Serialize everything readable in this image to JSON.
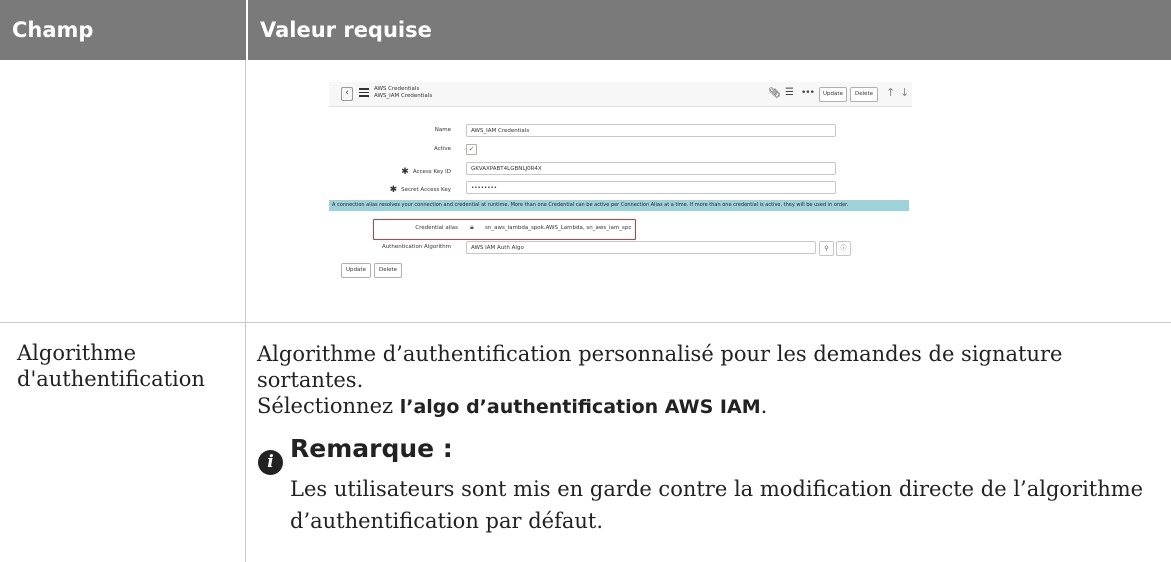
{
  "table": {
    "header_field": "Champ",
    "header_value": "Valeur requise"
  },
  "screenshot": {
    "title_line1": "AWS Credentials",
    "title_line2": "AWS_IAM Credentials",
    "update_label": "Update",
    "delete_label": "Delete",
    "fields": {
      "name_label": "Name",
      "name_value": "AWS_IAM Credentials",
      "active_label": "Active",
      "active_checked": true,
      "access_key_label": "Access Key ID",
      "access_key_value": "GKVAXPABT4LGBNLJ0R4X",
      "secret_label": "Secret Access Key",
      "secret_value": "••••••••",
      "alias_label": "Credential alias",
      "alias_value": "sn_aws_lambda_spok.AWS_Lambda, sn_aws_iam_spoke.AWS_IAM",
      "algo_label": "Authentication Algorithm",
      "algo_value": "AWS IAM Auth Algo"
    },
    "info_message": "A connection alias resolves your connection and credential at runtime. More than one Credential can be active per Connection Alias at a time. If more than one credential is active, they will be used in order.",
    "bottom_update": "Update",
    "bottom_delete": "Delete",
    "icons": [
      "back-icon",
      "menu-icon",
      "paperclip-icon",
      "sliders-icon",
      "more-icon",
      "arrow-up-icon",
      "arrow-down-icon",
      "lock-icon",
      "search-icon",
      "info-icon",
      "checkmark-icon"
    ]
  },
  "row2": {
    "field": "Algorithme d'authentification",
    "desc_line1": "Algorithme d’authentification personnalisé pour les demandes de signature sortantes.",
    "desc_line2_prefix": "Sélectionnez ",
    "desc_line2_bold": "l’algo d’authentification AWS IAM",
    "desc_line2_suffix": ".",
    "note_title": "Remarque :",
    "note_body": "Les utilisateurs sont mis en garde contre la modification directe de l’algorithme d’authentification par défaut."
  },
  "colors": {
    "header_bg": "#7a7a7a",
    "info_band": "#9fd2d8",
    "alias_border": "#dd3333"
  }
}
